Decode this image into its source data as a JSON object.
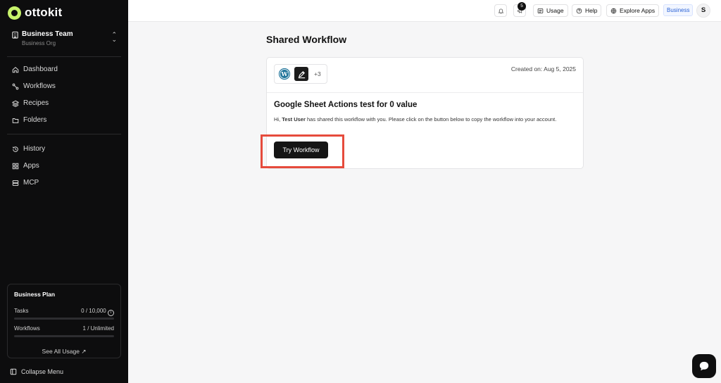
{
  "brand": {
    "name": "ottokit",
    "accent": "#c7f36b"
  },
  "team": {
    "name": "Business Team",
    "org": "Business Org"
  },
  "nav": {
    "primary": [
      {
        "label": "Dashboard",
        "icon": "home-icon"
      },
      {
        "label": "Workflows",
        "icon": "workflow-icon"
      },
      {
        "label": "Recipes",
        "icon": "layers-icon"
      },
      {
        "label": "Folders",
        "icon": "folder-icon"
      }
    ],
    "secondary": [
      {
        "label": "History",
        "icon": "history-icon"
      },
      {
        "label": "Apps",
        "icon": "grid-icon"
      },
      {
        "label": "MCP",
        "icon": "server-icon"
      }
    ]
  },
  "plan": {
    "title": "Business Plan",
    "tasks_label": "Tasks",
    "tasks_value": "0 / 10,000",
    "tasks_used_fraction": 0,
    "workflows_label": "Workflows",
    "workflows_value": "1 / Unlimited",
    "see_all": "See All Usage"
  },
  "collapse_label": "Collapse Menu",
  "header": {
    "notifications_count": "5",
    "usage_label": "Usage",
    "help_label": "Help",
    "explore_label": "Explore Apps",
    "plan_badge": "Business",
    "avatar_initial": "S"
  },
  "main": {
    "title": "Shared Workflow",
    "card": {
      "more_apps": "+3",
      "created": "Created on: Aug 5, 2025",
      "workflow_title": "Google Sheet Actions test for 0 value",
      "desc_prefix": "Hi, ",
      "desc_user": "Test User",
      "desc_suffix": " has shared this workflow with you. Please click on the button below to copy the workflow into your account.",
      "try_button": "Try Workflow"
    }
  }
}
